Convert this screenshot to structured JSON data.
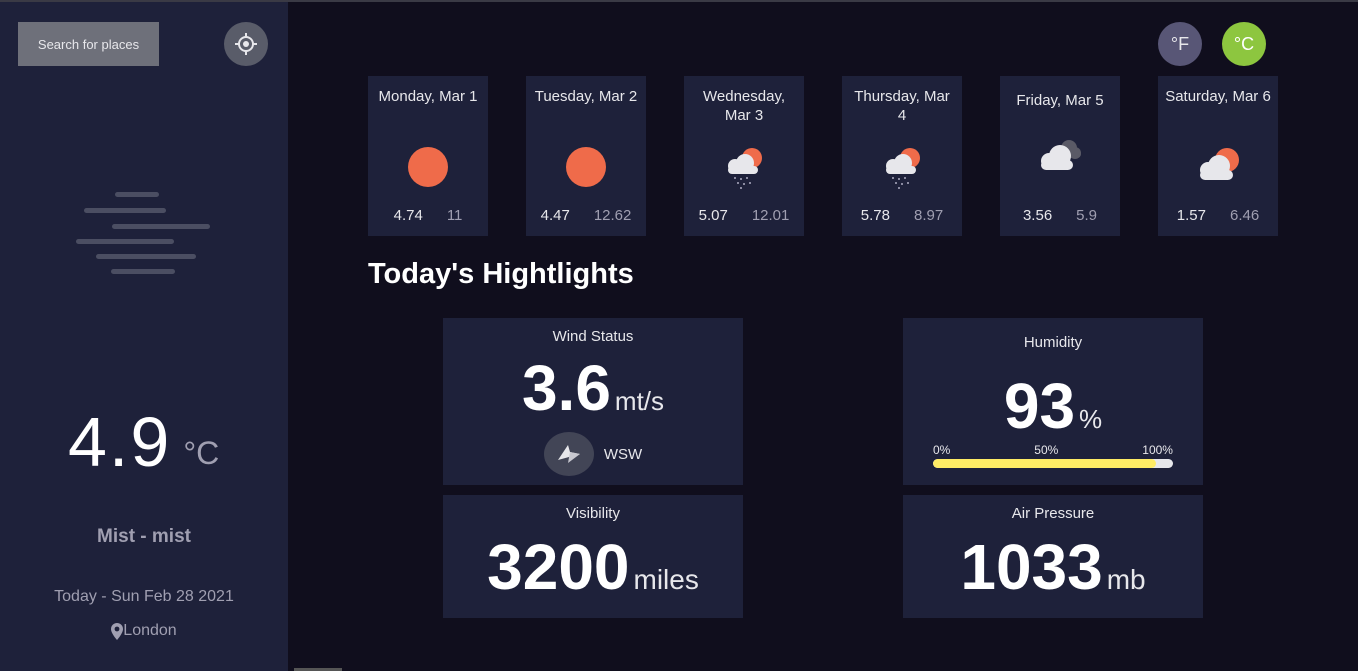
{
  "sidebar": {
    "search_label": "Search for places",
    "current_temp": "4.9",
    "current_unit": "°C",
    "weather_icon": "mist-icon",
    "description": "Mist - mist",
    "date": "Today - Sun Feb 28 2021",
    "location": "London"
  },
  "units": {
    "fahrenheit": "°F",
    "celsius": "°C",
    "active": "celsius",
    "active_color": "#8dc63f"
  },
  "forecast": [
    {
      "day": "Monday, Mar 1",
      "icon": "sun-icon",
      "low": "4.74",
      "high": "11"
    },
    {
      "day": "Tuesday, Mar 2",
      "icon": "sun-icon",
      "low": "4.47",
      "high": "12.62"
    },
    {
      "day": "Wednesday, Mar 3",
      "icon": "light-rain-icon",
      "low": "5.07",
      "high": "12.01"
    },
    {
      "day": "Thursday, Mar 4",
      "icon": "light-rain-icon",
      "low": "5.78",
      "high": "8.97"
    },
    {
      "day": "Friday, Mar 5",
      "icon": "heavy-cloud-icon",
      "low": "3.56",
      "high": "5.9"
    },
    {
      "day": "Saturday, Mar 6",
      "icon": "light-cloud-icon",
      "low": "1.57",
      "high": "6.46"
    }
  ],
  "highlights": {
    "title": "Today's Hightlights",
    "wind": {
      "label": "Wind Status",
      "value": "3.6",
      "unit": "mt/s",
      "direction": "WSW"
    },
    "humidity": {
      "label": "Humidity",
      "value": "93",
      "unit": "%",
      "percent": 93,
      "scale": [
        "0%",
        "50%",
        "100%"
      ]
    },
    "visibility": {
      "label": "Visibility",
      "value": "3200",
      "unit": "miles"
    },
    "pressure": {
      "label": "Air Pressure",
      "value": "1033",
      "unit": "mb"
    }
  }
}
